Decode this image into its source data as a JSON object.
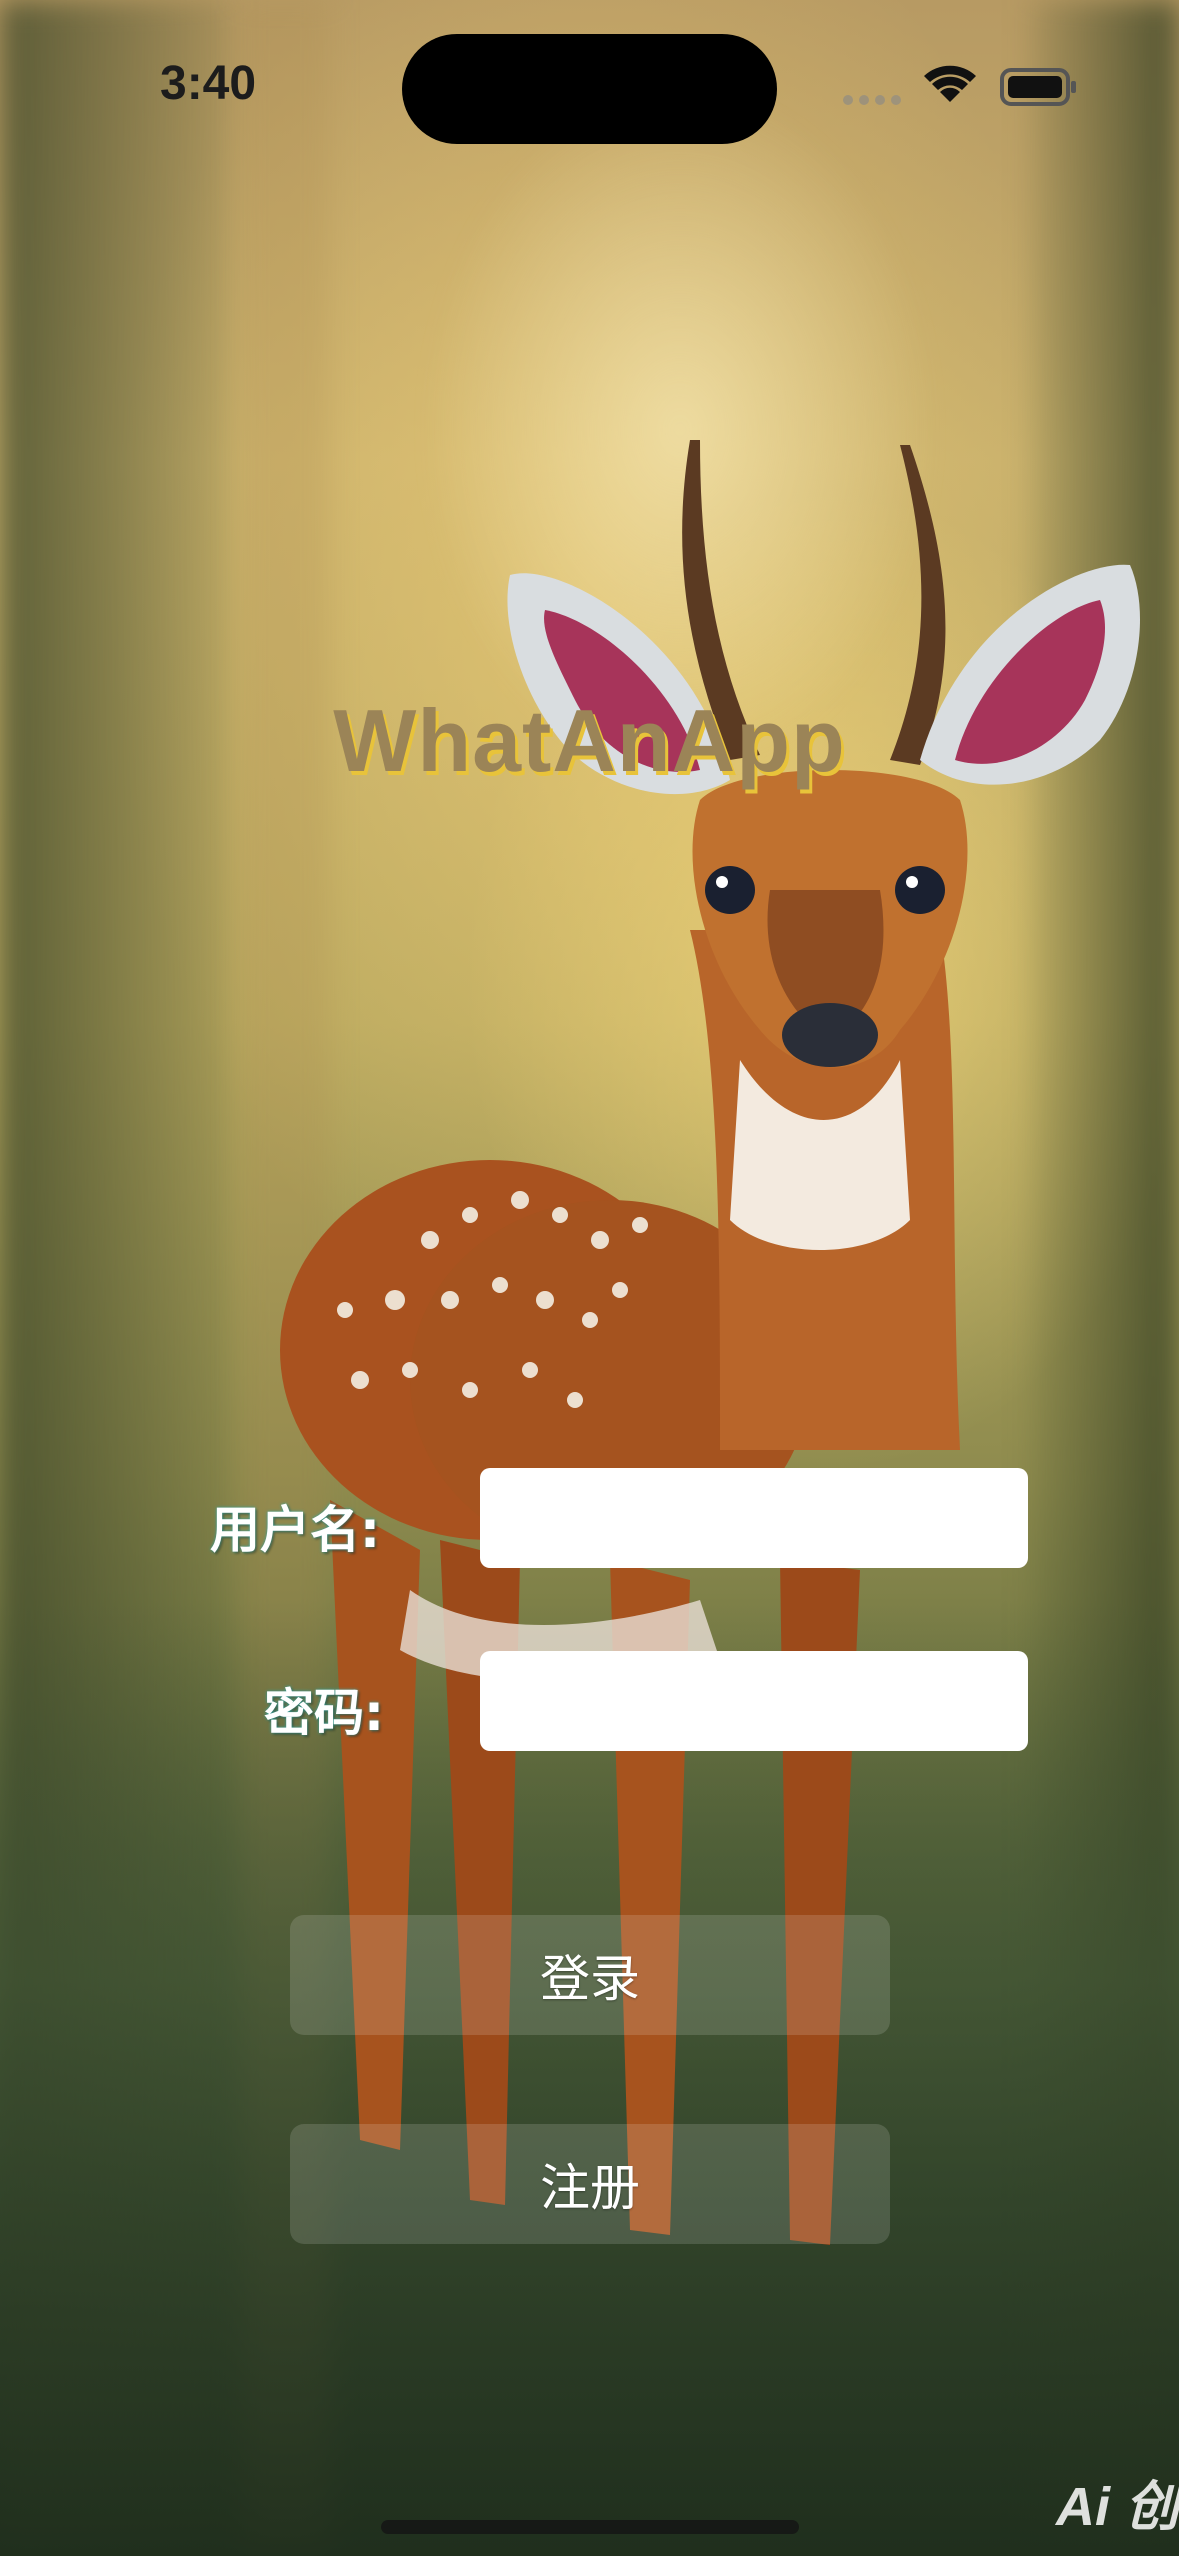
{
  "status_bar": {
    "time": "3:40"
  },
  "app": {
    "title": "WhatAnApp"
  },
  "form": {
    "username_label": "用户名:",
    "username_value": "",
    "password_label": "密码:",
    "password_value": ""
  },
  "buttons": {
    "login": "登录",
    "register": "注册"
  },
  "watermark": "Ai 创",
  "colors": {
    "title": "#9b8457",
    "title_shadow": "#e8c33a",
    "label_glow": "#2aa5a5"
  },
  "icons": [
    "wifi-icon",
    "battery-icon",
    "signal-dots-icon"
  ]
}
